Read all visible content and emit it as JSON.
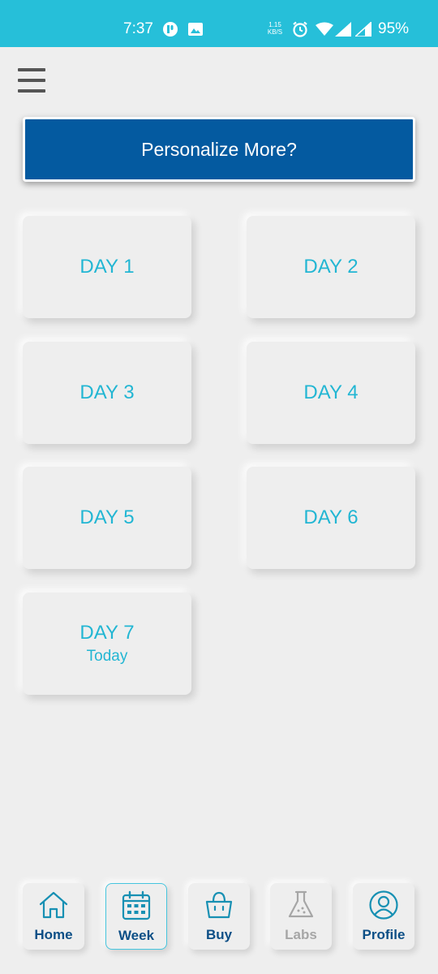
{
  "status_bar": {
    "time": "7:37",
    "network_speed_value": "1.15",
    "network_speed_unit": "KB/S",
    "battery": "95%"
  },
  "menu": {
    "icon": "hamburger-menu-icon"
  },
  "personalize_button": {
    "label": "Personalize More?"
  },
  "days": [
    {
      "label": "DAY 1",
      "sub": ""
    },
    {
      "label": "DAY 2",
      "sub": ""
    },
    {
      "label": "DAY 3",
      "sub": ""
    },
    {
      "label": "DAY 4",
      "sub": ""
    },
    {
      "label": "DAY 5",
      "sub": ""
    },
    {
      "label": "DAY 6",
      "sub": ""
    },
    {
      "label": "DAY 7",
      "sub": "Today"
    }
  ],
  "bottom_nav": {
    "active": "Week",
    "items": [
      {
        "label": "Home",
        "icon": "home-icon"
      },
      {
        "label": "Week",
        "icon": "calendar-icon"
      },
      {
        "label": "Buy",
        "icon": "shopping-basket-icon"
      },
      {
        "label": "Labs",
        "icon": "flask-icon",
        "disabled": true
      },
      {
        "label": "Profile",
        "icon": "profile-icon"
      }
    ]
  },
  "colors": {
    "status_bar": "#26bfd9",
    "primary_button": "#045aa0",
    "day_text": "#22b6d3",
    "nav_label": "#0d4f86",
    "nav_icon": "#1790b3",
    "nav_disabled": "#a6a6a6",
    "background": "#eeeeee"
  }
}
